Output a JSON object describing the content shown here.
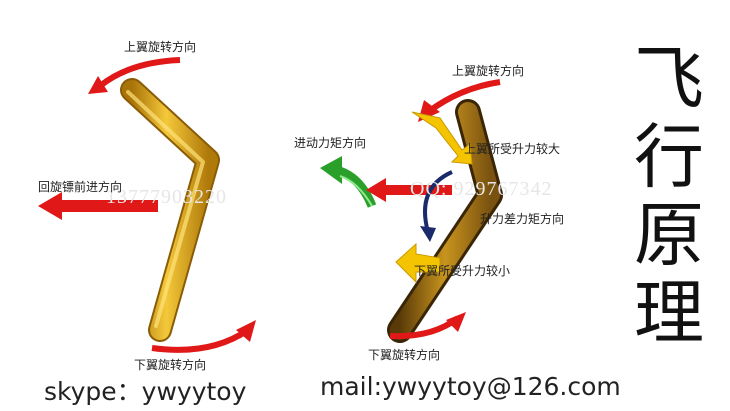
{
  "left_diagram": {
    "top_label": "上翼旋转方向",
    "forward_label": "回旋镖前进方向",
    "bottom_label": "下翼旋转方向"
  },
  "right_diagram": {
    "top_label": "上翼旋转方向",
    "moment_label": "进动力矩方向",
    "upper_lift_label": "上翼所受升力较大",
    "lift_diff_label": "升力差力矩方向",
    "lower_lift_label": "下翼所受升力较小",
    "bottom_label": "下翼旋转方向"
  },
  "watermarks": {
    "phone": "13777903220",
    "qq": "QQ: 929767342"
  },
  "title": [
    "飞",
    "行",
    "原",
    "理"
  ],
  "footer": {
    "skype": "skype：ywyytoy",
    "mail": "mail:ywyytoy@126.com"
  },
  "colors": {
    "boomerang": "#e0a818",
    "arrow_red": "#e01818",
    "arrow_green": "#2aa02a",
    "arrow_yellow": "#f5c400",
    "arrow_navy": "#1a2a6a"
  }
}
